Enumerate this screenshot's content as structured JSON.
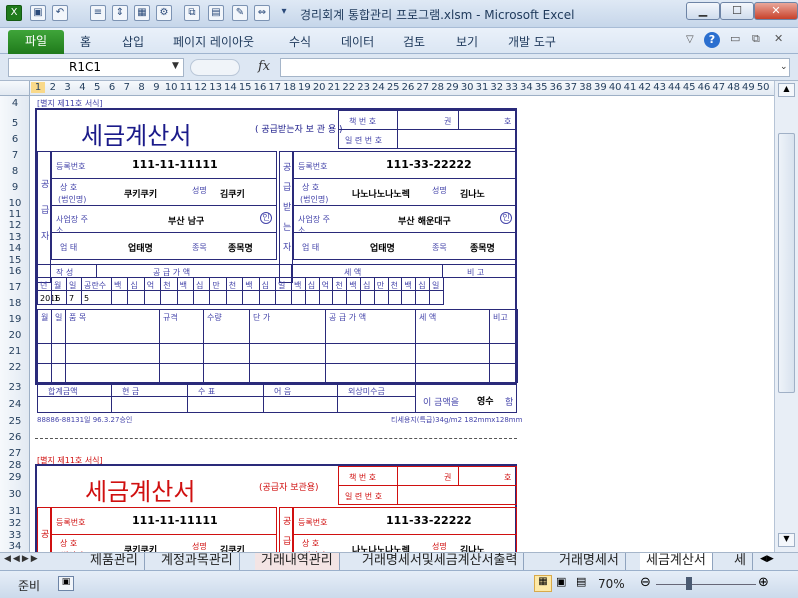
{
  "window": {
    "title": "경리회계 통합관리 프로그램.xlsm  -  Microsoft Excel"
  },
  "ribbon": {
    "file": "파일",
    "tabs": [
      "홈",
      "삽입",
      "페이지 레이아웃",
      "수식",
      "데이터",
      "검토",
      "보기",
      "개발 도구"
    ]
  },
  "formula": {
    "namebox": "R1C1",
    "fx": "fx"
  },
  "columns": [
    "1",
    "2",
    "3",
    "4",
    "5",
    "6",
    "7",
    "8",
    "9",
    "10",
    "11",
    "12",
    "13",
    "14",
    "15",
    "16",
    "17",
    "18",
    "19",
    "20",
    "21",
    "22",
    "23",
    "24",
    "25",
    "26",
    "27",
    "28",
    "29",
    "30",
    "31",
    "32",
    "33",
    "34",
    "35",
    "36",
    "37",
    "38",
    "39",
    "40",
    "41",
    "42",
    "43",
    "44",
    "45",
    "46",
    "47",
    "48",
    "49",
    "50"
  ],
  "rows": [
    "4",
    "5",
    "6",
    "7",
    "8",
    "9",
    "10",
    "11",
    "12",
    "13",
    "14",
    "15",
    "16",
    "17",
    "18",
    "19",
    "20",
    "21",
    "22",
    "23",
    "24",
    "25",
    "26",
    "27",
    "28",
    "29",
    "30",
    "31",
    "32",
    "33",
    "34"
  ],
  "invoice": {
    "form_no": "[별지 제11호 서식]",
    "title": "세금계산서",
    "recipient_copy": "( 공급받는자 보 관 용 )",
    "supplier_copy": "(공급자 보관용)",
    "book_no": "책 번 호",
    "gwon": "권",
    "ho": "호",
    "serial_no": "일 련 번 호",
    "reg_no_label": "등록번호",
    "supplier_reg": "111-11-11111",
    "buyer_reg": "111-33-22222",
    "name_label": "상   호",
    "name_sub": "(법인명)",
    "supplier_name": "쿠키쿠키",
    "buyer_name": "나노나노나노렉",
    "rep_label": "성명",
    "supplier_rep": "김쿠키",
    "buyer_rep": "김나노",
    "addr_label": "사업장 주 소",
    "supplier_addr": "부산 남구",
    "buyer_addr": "부산 해운대구",
    "seal": "인",
    "biz_label": "업   태",
    "supplier_biz": "업태명",
    "buyer_biz": "업태명",
    "item_label": "종목",
    "supplier_item": "종목명",
    "buyer_item": "종목명",
    "supplier_side": "공급자",
    "buyer_side": "공급받는자",
    "made_label": "작  성",
    "supply_label": "공    급    가    액",
    "tax_label": "세          액",
    "note_label": "비    고",
    "date_head": [
      "년",
      "월",
      "일",
      "공란수"
    ],
    "digit_head": [
      "백",
      "십",
      "억",
      "천",
      "백",
      "십",
      "만",
      "천",
      "백",
      "십",
      "일"
    ],
    "date_vals": [
      "2016",
      "1",
      "7",
      "5"
    ],
    "item_cols": [
      "월",
      "일",
      "품    목",
      "규격",
      "수량",
      "단    가",
      "공 급 가 액",
      "세    액",
      "비고"
    ],
    "total_cols": [
      "합계금액",
      "현    금",
      "수    표",
      "어    음",
      "외상미수금"
    ],
    "receipt": "이 금액을",
    "receipt_val": "영수",
    "receipt_end": "함",
    "footer_left": "88886-88131일 96.3.27승인",
    "footer_right": "티세용지(특급)34g/m2 182mmx128mm"
  },
  "sheets": [
    "제품관리",
    "계정과목관리",
    "거래내역관리",
    "거래명세서및세금계산서출력",
    "거래명세서",
    "세금계산서",
    "세"
  ],
  "status": {
    "ready": "준비",
    "zoom": "70%"
  }
}
